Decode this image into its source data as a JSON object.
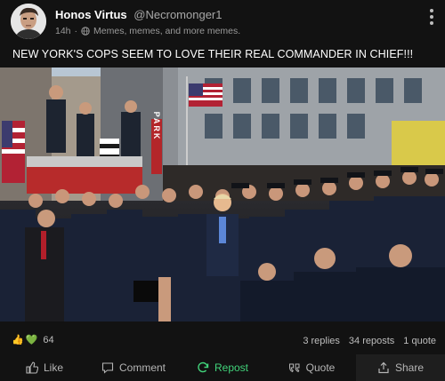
{
  "post": {
    "author": {
      "display_name": "Honos Virtus",
      "handle": "@Necromonger1"
    },
    "meta": {
      "time": "14h",
      "separator": "·",
      "audience": "Memes, memes, and more memes."
    },
    "text": "NEW YORK'S COPS SEEM TO LOVE THEIR REAL COMMANDER IN CHIEF!!!",
    "image": {
      "storefront_sign": "PARK"
    },
    "reactions": {
      "emojis": [
        "👍",
        "💚"
      ],
      "count": "64"
    },
    "counts": {
      "replies": "3 replies",
      "reposts": "34 reposts",
      "quotes": "1 quote"
    }
  },
  "actions": {
    "like": "Like",
    "comment": "Comment",
    "repost": "Repost",
    "quote": "Quote",
    "share": "Share"
  },
  "colors": {
    "background": "#121212",
    "repost_active": "#41d37a",
    "text_muted": "#9a9a9a"
  },
  "icons": [
    "globe-icon",
    "more-options-icon",
    "like-icon",
    "comment-icon",
    "repost-icon",
    "quote-icon",
    "share-icon"
  ]
}
